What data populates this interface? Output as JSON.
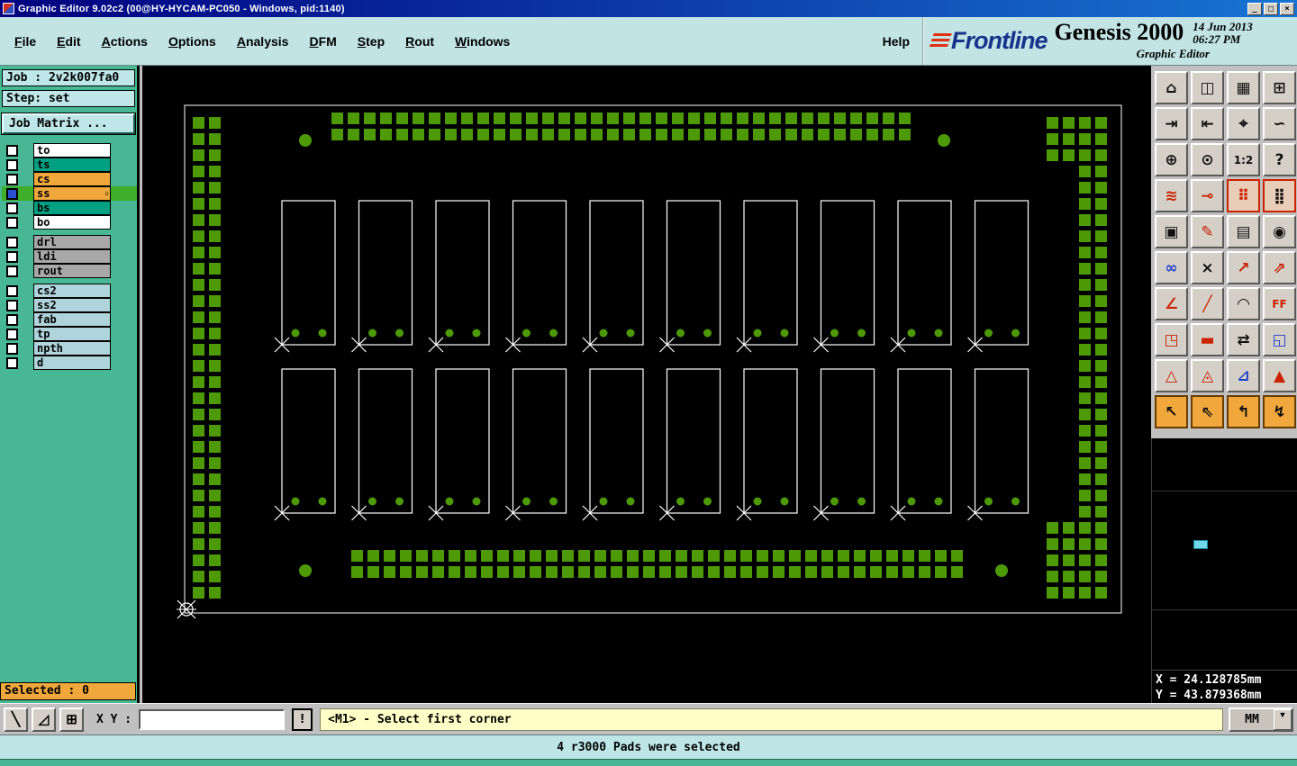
{
  "window": {
    "title": "Graphic Editor 9.02c2 (00@HY-HYCAM-PC050 - Windows, pid:1140)",
    "minimize": "_",
    "maximize": "□",
    "close": "×"
  },
  "menubar": {
    "items": [
      "File",
      "Edit",
      "Actions",
      "Options",
      "Analysis",
      "DFM",
      "Step",
      "Rout",
      "Windows"
    ],
    "help": "Help"
  },
  "branding": {
    "logo": "Frontline",
    "product": "Genesis 2000",
    "date": "14 Jun 2013",
    "time": "06:27 PM",
    "subtitle": "Graphic Editor"
  },
  "sidebar": {
    "job_label": "Job : 2v2k007fa0",
    "step_label": "Step: set",
    "matrix_button": "Job Matrix ...",
    "active_indicator": "▫",
    "layers": [
      {
        "name": "to",
        "color": "#ffffff",
        "group": 1
      },
      {
        "name": "ts",
        "color": "#00a183",
        "group": 1
      },
      {
        "name": "cs",
        "color": "#f0a83c",
        "group": 1
      },
      {
        "name": "ss",
        "color": "#f0a83c",
        "group": 1,
        "selected": true
      },
      {
        "name": "bs",
        "color": "#00a183",
        "group": 1
      },
      {
        "name": "bo",
        "color": "#ffffff",
        "group": 1
      },
      {
        "name": "drl",
        "color": "#a8a8a8",
        "group": 2
      },
      {
        "name": "ldi",
        "color": "#a8a8a8",
        "group": 2
      },
      {
        "name": "rout",
        "color": "#a8a8a8",
        "group": 2
      },
      {
        "name": "cs2",
        "color": "#b0d4dc",
        "group": 3
      },
      {
        "name": "ss2",
        "color": "#b0d4dc",
        "group": 3
      },
      {
        "name": "fab",
        "color": "#b0d4dc",
        "group": 3
      },
      {
        "name": "tp",
        "color": "#b0d4dc",
        "group": 3
      },
      {
        "name": "npth",
        "color": "#b0d4dc",
        "group": 3
      },
      {
        "name": "d",
        "color": "#b0d4dc",
        "group": 3
      }
    ],
    "selected_label": "Selected : 0"
  },
  "toolbar": {
    "buttons": [
      {
        "name": "tool-clipboard",
        "glyph": "⌂",
        "ink": "dark",
        "cls": ""
      },
      {
        "name": "tool-display",
        "glyph": "◫",
        "ink": "dark",
        "cls": ""
      },
      {
        "name": "tool-plot",
        "glyph": "▦",
        "ink": "dark",
        "cls": ""
      },
      {
        "name": "tool-split-view",
        "glyph": "⊞",
        "ink": "dark",
        "cls": ""
      },
      {
        "name": "tool-zoom-in-window",
        "glyph": "⇥",
        "ink": "dark",
        "cls": ""
      },
      {
        "name": "tool-zoom-out-window",
        "glyph": "⇤",
        "ink": "dark",
        "cls": ""
      },
      {
        "name": "tool-zoom-scale",
        "glyph": "⌖",
        "ink": "dark",
        "cls": ""
      },
      {
        "name": "tool-redraw",
        "glyph": "∽",
        "ink": "dark",
        "cls": ""
      },
      {
        "name": "tool-fit-view",
        "glyph": "⊕",
        "ink": "dark",
        "cls": ""
      },
      {
        "name": "tool-pan-center",
        "glyph": "⊙",
        "ink": "dark",
        "cls": ""
      },
      {
        "name": "tool-zoom-1-2",
        "glyph": "1:2",
        "ink": "dark",
        "cls": "small-text"
      },
      {
        "name": "tool-help",
        "glyph": "?",
        "ink": "dark",
        "cls": ""
      },
      {
        "name": "tool-layer-compare",
        "glyph": "≋",
        "ink": "red",
        "cls": ""
      },
      {
        "name": "tool-measure-point",
        "glyph": "⊸",
        "ink": "red",
        "cls": ""
      },
      {
        "name": "tool-grid-snap",
        "glyph": "⠿",
        "ink": "red",
        "cls": "hl-red"
      },
      {
        "name": "tool-grid-dots",
        "glyph": "⣿",
        "ink": "dark",
        "cls": "hl-red"
      },
      {
        "name": "tool-clip-view",
        "glyph": "▣",
        "ink": "dark",
        "cls": ""
      },
      {
        "name": "tool-edit-window",
        "glyph": "✎",
        "ink": "red",
        "cls": ""
      },
      {
        "name": "tool-ruler",
        "glyph": "▤",
        "ink": "dark",
        "cls": ""
      },
      {
        "name": "tool-origin",
        "glyph": "◉",
        "ink": "dark",
        "cls": ""
      },
      {
        "name": "tool-net-highlight",
        "glyph": "∞",
        "ink": "blue",
        "cls": ""
      },
      {
        "name": "tool-delete",
        "glyph": "×",
        "ink": "dark",
        "cls": ""
      },
      {
        "name": "tool-move-vertex",
        "glyph": "↗",
        "ink": "red",
        "cls": ""
      },
      {
        "name": "tool-copy-vertex",
        "glyph": "⇗",
        "ink": "red",
        "cls": ""
      },
      {
        "name": "tool-measure-angle",
        "glyph": "∠",
        "ink": "red",
        "cls": ""
      },
      {
        "name": "tool-measure-line",
        "glyph": "╱",
        "ink": "red",
        "cls": ""
      },
      {
        "name": "tool-measure-arc",
        "glyph": "◠",
        "ink": "dark",
        "cls": ""
      },
      {
        "name": "tool-text",
        "glyph": "FF",
        "ink": "red",
        "cls": "small-text"
      },
      {
        "name": "tool-pad-edit",
        "glyph": "◳",
        "ink": "red",
        "cls": ""
      },
      {
        "name": "tool-line-edit",
        "glyph": "▬",
        "ink": "red",
        "cls": ""
      },
      {
        "name": "tool-stretch",
        "glyph": "⇄",
        "ink": "dark",
        "cls": ""
      },
      {
        "name": "tool-surface",
        "glyph": "◱",
        "ink": "blue",
        "cls": ""
      },
      {
        "name": "tool-triangle-open",
        "glyph": "△",
        "ink": "red",
        "cls": ""
      },
      {
        "name": "tool-triangle-label",
        "glyph": "◬",
        "ink": "red",
        "cls": ""
      },
      {
        "name": "tool-triangle-measure",
        "glyph": "⊿",
        "ink": "blue",
        "cls": ""
      },
      {
        "name": "tool-triangle-filled",
        "glyph": "▲",
        "ink": "red",
        "cls": ""
      },
      {
        "name": "tool-select-single",
        "glyph": "↖",
        "ink": "dark",
        "cls": "hl-orange"
      },
      {
        "name": "tool-select-window",
        "glyph": "⇖",
        "ink": "dark",
        "cls": "hl-orange"
      },
      {
        "name": "tool-select-query",
        "glyph": "↰",
        "ink": "dark",
        "cls": "hl-orange"
      },
      {
        "name": "tool-select-filter",
        "glyph": "↯",
        "ink": "dark",
        "cls": "hl-orange"
      }
    ]
  },
  "bottombar": {
    "snap_button": "╲",
    "angle_button": "◿",
    "grid_button": "⊞",
    "xy_label": "X Y :",
    "xy_value": "",
    "alert_button": "!",
    "prompt": "<M1> - Select first corner",
    "units": "MM",
    "units_drop": "▼"
  },
  "readout": {
    "x": "X = 24.128785mm",
    "y": "Y = 43.879368mm"
  },
  "message": "4 r3000 Pads were selected",
  "colors": {
    "pad_green": "#4e9a06",
    "outline_white": "#ffffff",
    "canvas_bg": "#000000",
    "sidebar_teal": "#48b894",
    "accent_orange": "#f0a83c"
  }
}
